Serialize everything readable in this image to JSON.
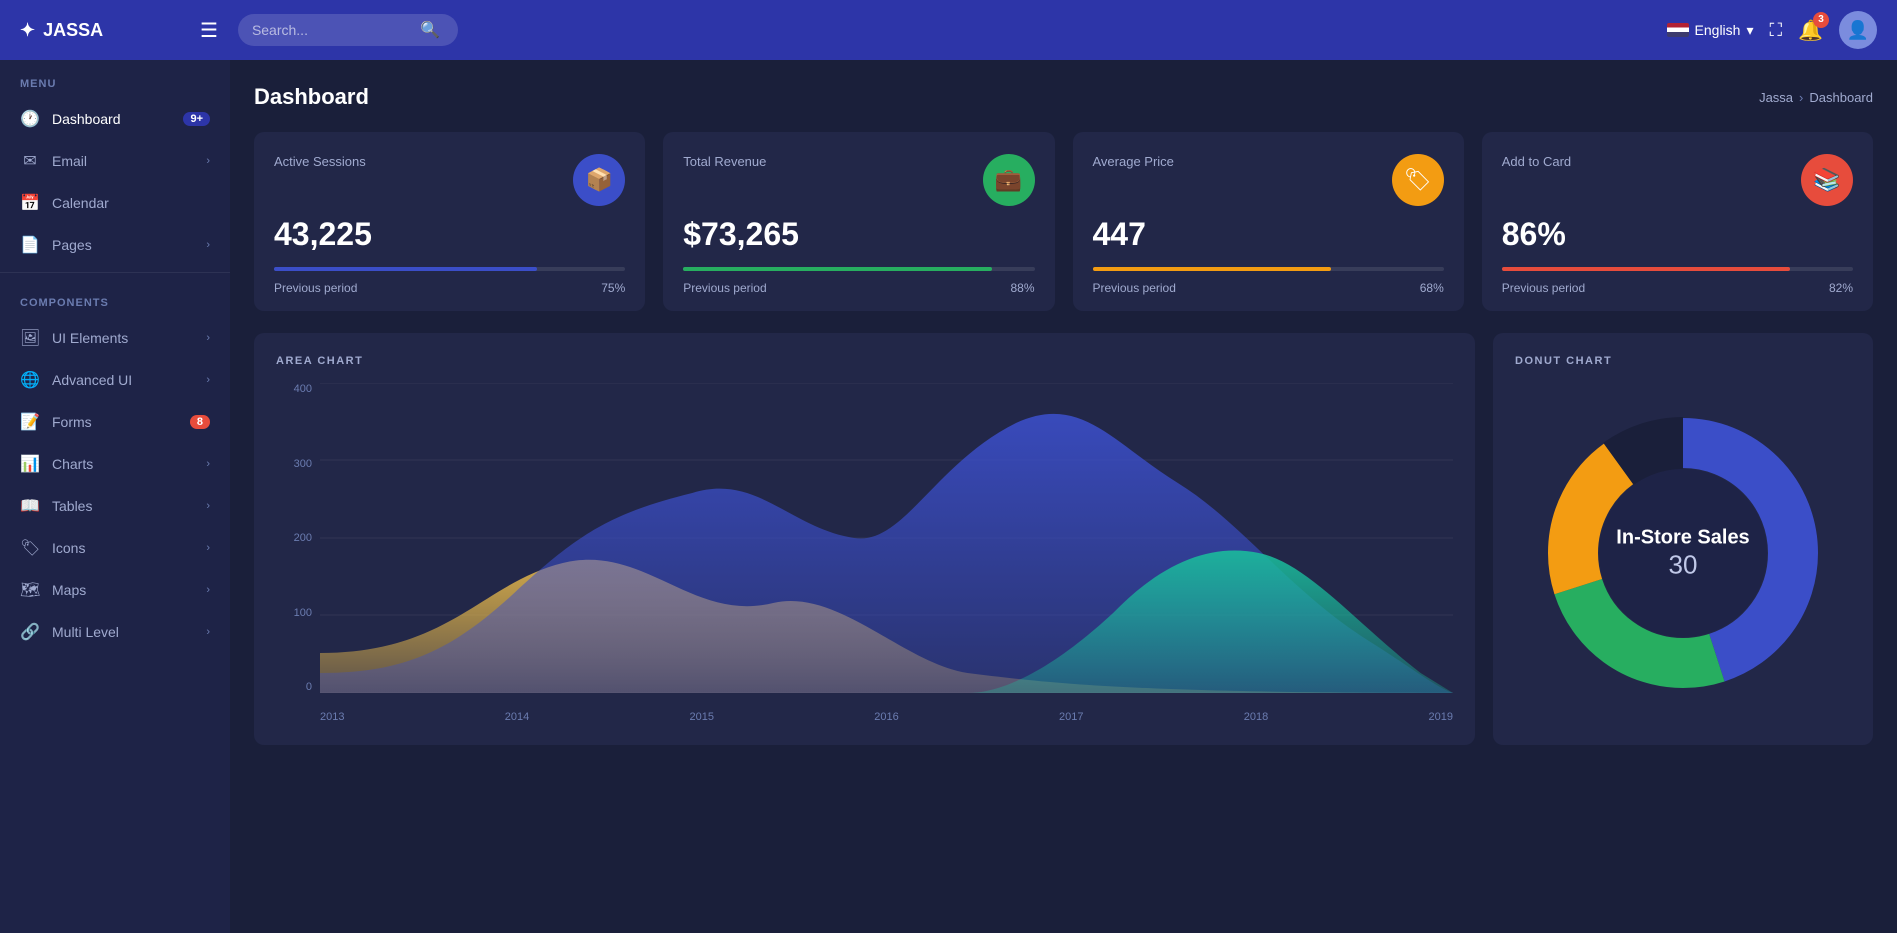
{
  "app": {
    "logo": "JASSA",
    "logo_icon": "✦"
  },
  "topnav": {
    "search_placeholder": "Search...",
    "language": "English",
    "notif_count": "3"
  },
  "sidebar": {
    "menu_label": "MENU",
    "components_label": "COMPONENTS",
    "items_menu": [
      {
        "id": "dashboard",
        "label": "Dashboard",
        "icon": "🕐",
        "badge": "9+",
        "badge_color": "blue",
        "arrow": false
      },
      {
        "id": "email",
        "label": "Email",
        "icon": "✉",
        "badge": null,
        "arrow": true
      },
      {
        "id": "calendar",
        "label": "Calendar",
        "icon": "📅",
        "badge": null,
        "arrow": false
      },
      {
        "id": "pages",
        "label": "Pages",
        "icon": "📄",
        "badge": null,
        "arrow": true
      }
    ],
    "items_components": [
      {
        "id": "ui-elements",
        "label": "UI Elements",
        "icon": "🖼",
        "badge": null,
        "arrow": true
      },
      {
        "id": "advanced-ui",
        "label": "Advanced UI",
        "icon": "🌐",
        "badge": null,
        "arrow": true
      },
      {
        "id": "forms",
        "label": "Forms",
        "icon": "📝",
        "badge": "8",
        "badge_color": "red",
        "arrow": false
      },
      {
        "id": "charts",
        "label": "Charts",
        "icon": "📊",
        "badge": null,
        "arrow": true
      },
      {
        "id": "tables",
        "label": "Tables",
        "icon": "📖",
        "badge": null,
        "arrow": true
      },
      {
        "id": "icons",
        "label": "Icons",
        "icon": "🏷",
        "badge": null,
        "arrow": true
      },
      {
        "id": "maps",
        "label": "Maps",
        "icon": "🗺",
        "badge": null,
        "arrow": true
      },
      {
        "id": "multi-level",
        "label": "Multi Level",
        "icon": "🔗",
        "badge": null,
        "arrow": true
      }
    ]
  },
  "page": {
    "title": "Dashboard",
    "breadcrumb": [
      "Jassa",
      "Dashboard"
    ]
  },
  "stat_cards": [
    {
      "id": "active-sessions",
      "title": "Active Sessions",
      "icon": "📦",
      "icon_color": "blue",
      "value": "43,225",
      "bar_color": "blue",
      "bar_pct": 75,
      "period_label": "Previous period",
      "period_value": "75%"
    },
    {
      "id": "total-revenue",
      "title": "Total Revenue",
      "icon": "💼",
      "icon_color": "green",
      "value": "$73,265",
      "bar_color": "green",
      "bar_pct": 88,
      "period_label": "Previous period",
      "period_value": "88%"
    },
    {
      "id": "average-price",
      "title": "Average Price",
      "icon": "🏷",
      "icon_color": "yellow",
      "value": "447",
      "bar_color": "yellow",
      "bar_pct": 68,
      "period_label": "Previous period",
      "period_value": "68%"
    },
    {
      "id": "add-to-card",
      "title": "Add to Card",
      "icon": "📚",
      "icon_color": "red",
      "value": "86%",
      "bar_color": "red",
      "bar_pct": 82,
      "period_label": "Previous period",
      "period_value": "82%"
    }
  ],
  "area_chart": {
    "title": "AREA CHART",
    "y_labels": [
      "400",
      "300",
      "200",
      "100",
      "0"
    ],
    "x_labels": [
      "2013",
      "2014",
      "2015",
      "2016",
      "2017",
      "2018",
      "2019"
    ]
  },
  "donut_chart": {
    "title": "DONUT CHART",
    "center_label": "In-Store Sales",
    "center_value": "30",
    "segments": [
      {
        "color": "#3b4ec8",
        "pct": 45
      },
      {
        "color": "#27ae60",
        "pct": 25
      },
      {
        "color": "#f39c12",
        "pct": 20
      },
      {
        "color": "#1a1f3a",
        "pct": 10
      }
    ]
  }
}
